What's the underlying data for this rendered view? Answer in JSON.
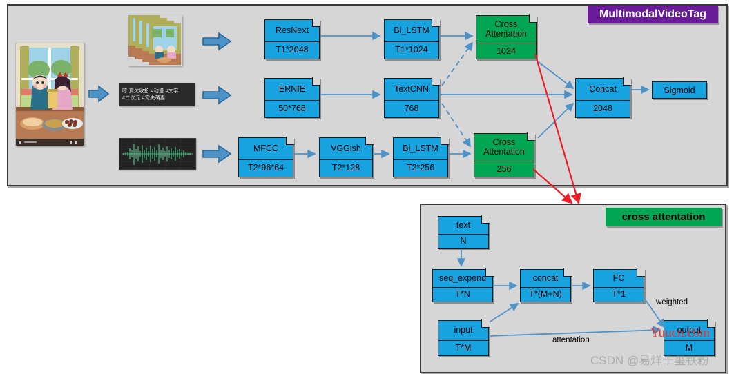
{
  "main_panel": {
    "title": "MultimodalVideoTag",
    "title_bg": "#6a1b9a",
    "nodes": [
      {
        "id": "resnext",
        "label": "ResNext",
        "value": "T1*2048",
        "color": "#17a3e0"
      },
      {
        "id": "bilstm_v",
        "label": "Bi_LSTM",
        "value": "T1*1024",
        "color": "#17a3e0"
      },
      {
        "id": "cross_att_top",
        "label": "Cross\nAttentation",
        "value": "1024",
        "color": "#00a651"
      },
      {
        "id": "ernie",
        "label": "ERNIE",
        "value": "50*768",
        "color": "#17a3e0"
      },
      {
        "id": "textcnn",
        "label": "TextCNN",
        "value": "768",
        "color": "#17a3e0"
      },
      {
        "id": "mfcc",
        "label": "MFCC",
        "value": "T2*96*64",
        "color": "#17a3e0"
      },
      {
        "id": "vggish",
        "label": "VGGish",
        "value": "T2*128",
        "color": "#17a3e0"
      },
      {
        "id": "bilstm_a",
        "label": "Bi_LSTM",
        "value": "T2*256",
        "color": "#17a3e0"
      },
      {
        "id": "cross_att_bottom",
        "label": "Cross\nAttentation",
        "value": "256",
        "color": "#00a651"
      },
      {
        "id": "concat",
        "label": "Concat",
        "value": "2048",
        "color": "#17a3e0"
      },
      {
        "id": "sigmoid",
        "label": "Sigmoid",
        "value": "",
        "color": "#17a3e0"
      }
    ],
    "media": {
      "video_poster_alt": "cartoon couple at dinner table",
      "frames_alt": "stacked video frames",
      "text_line1": "哼 真欠收拾 #动漫 #文字",
      "text_line2": "#二次元 #宠夫萌妻",
      "audio_alt": "audio waveform"
    }
  },
  "detail_panel": {
    "title": "cross attentation",
    "title_bg": "#00a651",
    "nodes": [
      {
        "id": "text",
        "label": "text",
        "value": "N"
      },
      {
        "id": "seq_expend",
        "label": "seq_expend",
        "value": "T*N"
      },
      {
        "id": "concat_d",
        "label": "concat",
        "value": "T*(M+N)"
      },
      {
        "id": "fc",
        "label": "FC",
        "value": "T*1"
      },
      {
        "id": "input",
        "label": "input",
        "value": "T*M"
      },
      {
        "id": "output",
        "label": "output",
        "value": "M"
      }
    ],
    "labels": {
      "weighted": "weighted",
      "attentation": "attentation"
    }
  },
  "watermarks": {
    "csdn": "CSDN @易烊千玺铁粉",
    "yuucn": "Yuucn.com",
    "yuucn_color": "#e8312a"
  },
  "colors": {
    "node_blue": "#17a3e0",
    "node_green": "#00a651",
    "panel_bg": "#d6d6d6",
    "wire_blue": "#4e93c8",
    "wire_red": "#ee1c25",
    "title_purple": "#6a1b9a"
  }
}
